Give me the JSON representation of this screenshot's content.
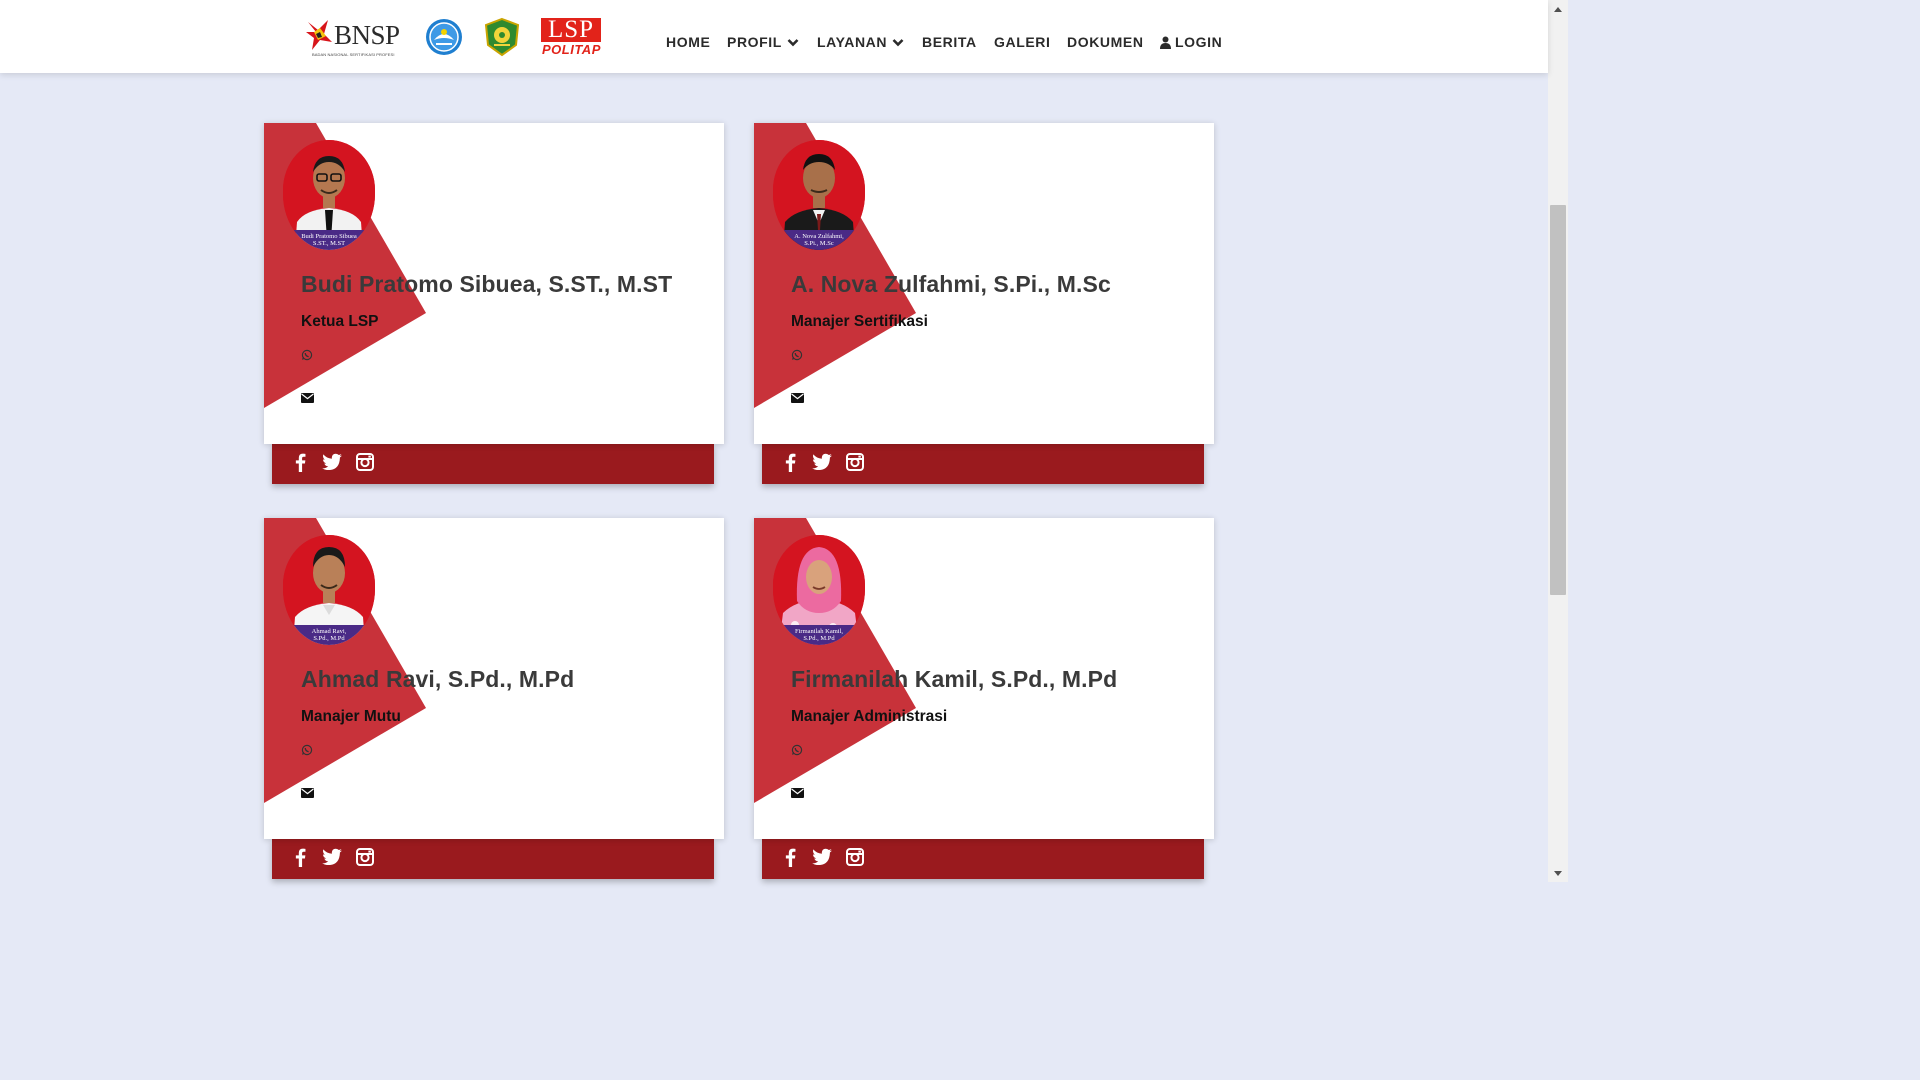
{
  "header": {
    "logos": {
      "bnsp_text": "BNSP",
      "bnsp_sub": "BADAN NASIONAL SERTIFIKASI PROFESI",
      "lsp_text": "LSP",
      "lsp_sub": "POLITAP"
    },
    "nav": {
      "home": "HOME",
      "profil": "PROFIL",
      "layanan": "LAYANAN",
      "berita": "BERITA",
      "galeri": "GALERI",
      "dokumen": "DOKUMEN",
      "login": "LOGIN"
    }
  },
  "colors": {
    "page_bg": "#e5e9f6",
    "accent_red": "#c8323a",
    "bar_red": "#9a1a1e",
    "caption_purple": "#4a2a86"
  },
  "icons": {
    "nav_dropdown": "chevron-down-icon",
    "login": "user-icon",
    "contact_phone": "whatsapp-icon",
    "contact_email": "envelope-icon",
    "social": [
      "facebook-icon",
      "twitter-icon",
      "instagram-icon"
    ]
  },
  "team": [
    {
      "name": "Budi Pratomo Sibuea, S.ST., M.ST",
      "role": "Ketua LSP",
      "photo_caption_1": "Budi Pratomo Sibuea",
      "photo_caption_2": "S.ST., M.ST"
    },
    {
      "name": "A. Nova Zulfahmi, S.Pi., M.Sc",
      "role": "Manajer Sertifikasi",
      "photo_caption_1": "A. Nova Zulfahmi,",
      "photo_caption_2": "S.Pi., M.Sc"
    },
    {
      "name": "Ahmad Ravi, S.Pd., M.Pd",
      "role": "Manajer Mutu",
      "photo_caption_1": "Ahmad Ravi,",
      "photo_caption_2": "S.Pd., M.Pd"
    },
    {
      "name": "Firmanilah Kamil, S.Pd., M.Pd",
      "role": "Manajer Administrasi",
      "photo_caption_1": "Firmanilah Kamil,",
      "photo_caption_2": "S.Pd., M.Pd"
    }
  ]
}
